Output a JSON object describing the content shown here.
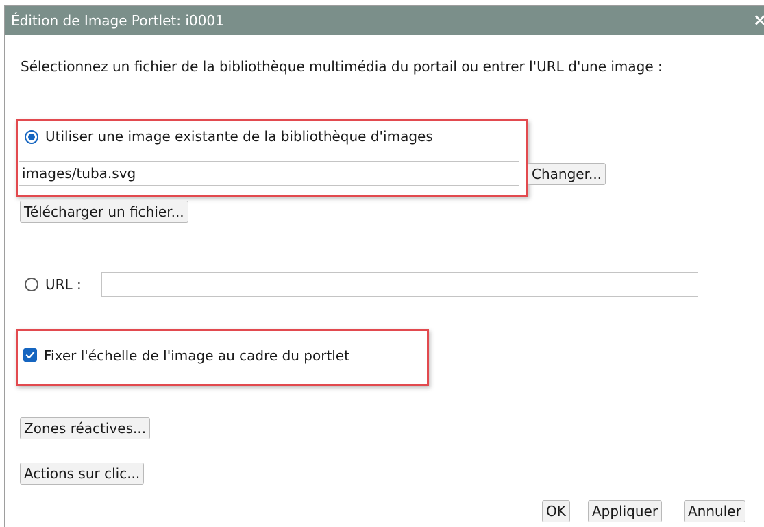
{
  "window": {
    "title": "Édition de Image Portlet: i0001",
    "close_symbol": "×"
  },
  "intro_text": "Sélectionnez un fichier de la bibliothèque multimédia du portail ou entrer l'URL d'une image :",
  "library_option": {
    "label": "Utiliser une image existante de la bibliothèque d'images",
    "selected": true,
    "path_value": "images/tuba.svg",
    "change_label": "Changer...",
    "upload_label": "Télécharger un fichier..."
  },
  "url_option": {
    "label": "URL :",
    "selected": false,
    "value": ""
  },
  "scale_checkbox": {
    "label": "Fixer l'échelle de l'image au cadre du portlet",
    "checked": true
  },
  "buttons": {
    "hotspots": "Zones réactives...",
    "click_actions": "Actions sur clic...",
    "ok": "OK",
    "apply": "Appliquer",
    "cancel": "Annuler"
  },
  "colors": {
    "titlebar": "#7b8f8a",
    "accent": "#1565c0",
    "highlight": "#e24a4f"
  },
  "icons": {
    "close": "close-icon",
    "radio": "radio-icon",
    "check": "check-icon"
  }
}
